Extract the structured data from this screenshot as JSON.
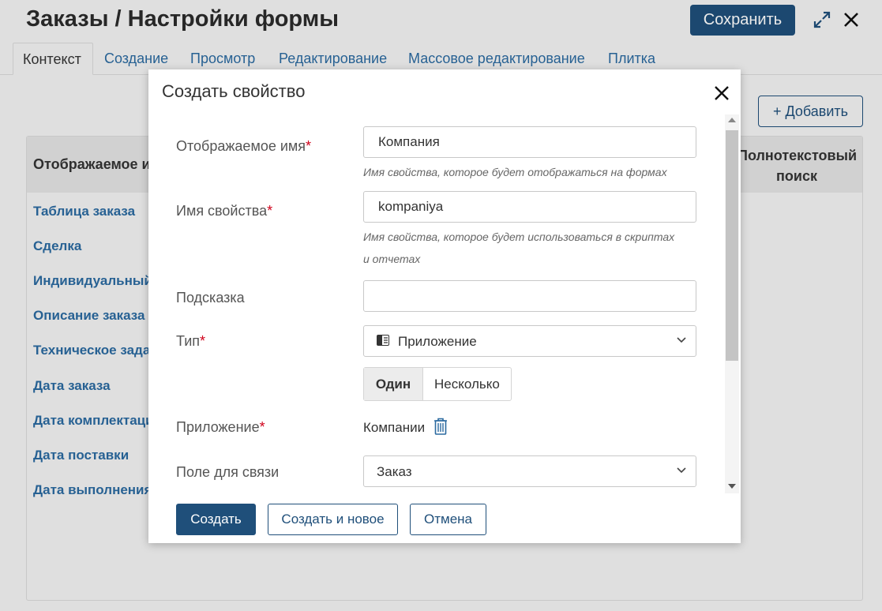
{
  "header": {
    "title": "Заказы / Настройки формы",
    "save_label": "Сохранить"
  },
  "tabs": [
    {
      "label": "Контекст",
      "active": true
    },
    {
      "label": "Создание"
    },
    {
      "label": "Просмотр"
    },
    {
      "label": "Редактирование"
    },
    {
      "label": "Массовое редактирование"
    },
    {
      "label": "Плитка"
    }
  ],
  "toolbar": {
    "add_label": "+ Добавить"
  },
  "table": {
    "col_name": "Отображаемое имя",
    "col_fts": "Полнотекстовый поиск",
    "rows": [
      "Таблица заказа",
      "Сделка",
      "Индивидуальный",
      "Описание заказа",
      "Техническое задание",
      "Дата заказа",
      "Дата комплектации",
      "Дата поставки",
      "Дата выполнения"
    ]
  },
  "modal": {
    "title": "Создать свойство",
    "fields": {
      "display_name": {
        "label": "Отображаемое имя",
        "value": "Компания",
        "hint": "Имя свойства, которое будет отображаться на формах"
      },
      "property_name": {
        "label": "Имя свойства",
        "value": "kompaniya",
        "hint": "Имя свойства, которое будет использоваться в скриптах и отчетах"
      },
      "tooltip": {
        "label": "Подсказка",
        "value": ""
      },
      "type": {
        "label": "Тип",
        "value": "Приложение"
      },
      "multiplicity": {
        "options": [
          "Один",
          "Несколько"
        ],
        "selected": "Один"
      },
      "application": {
        "label": "Приложение",
        "value": "Компании"
      },
      "link_field": {
        "label": "Поле для связи",
        "value": "Заказ"
      }
    },
    "buttons": {
      "create": "Создать",
      "create_new": "Создать и новое",
      "cancel": "Отмена"
    }
  },
  "colors": {
    "primary": "#1f4f7a",
    "link": "#2b6aa0",
    "required": "#d0021b"
  },
  "icons": {
    "expand": "expand-icon",
    "close": "close-icon",
    "app": "app-icon",
    "trash": "trash-icon",
    "chevron": "chevron-down-icon"
  }
}
